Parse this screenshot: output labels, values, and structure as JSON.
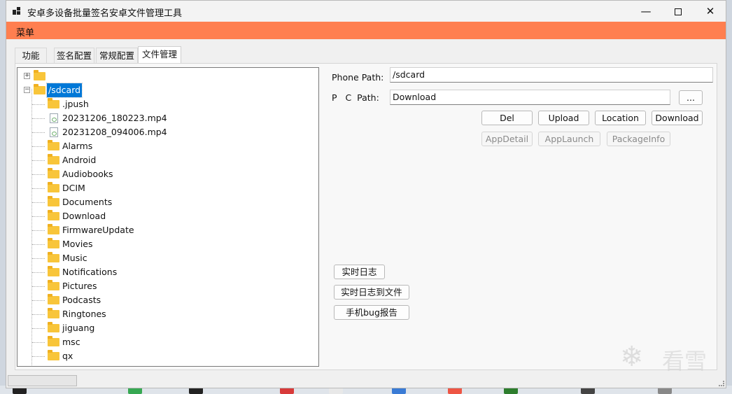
{
  "window": {
    "title": "安卓多设备批量签名安卓文件管理工具",
    "minimize_glyph": "—",
    "close_glyph": "✕"
  },
  "menu": {
    "items": [
      {
        "label": "菜单"
      }
    ]
  },
  "tabs": [
    {
      "label": "功能",
      "active": false
    },
    {
      "label": "签名配置",
      "active": false
    },
    {
      "label": "常规配置",
      "active": false
    },
    {
      "label": "文件管理",
      "active": true
    }
  ],
  "tree": {
    "root_collapsed": {
      "label": "",
      "expander": "+"
    },
    "root_expanded": {
      "label": "/sdcard",
      "expander": "−",
      "selected": true
    },
    "children": [
      {
        "label": ".jpush",
        "type": "folder"
      },
      {
        "label": "20231206_180223.mp4",
        "type": "file"
      },
      {
        "label": "20231208_094006.mp4",
        "type": "file"
      },
      {
        "label": "Alarms",
        "type": "folder"
      },
      {
        "label": "Android",
        "type": "folder"
      },
      {
        "label": "Audiobooks",
        "type": "folder"
      },
      {
        "label": "DCIM",
        "type": "folder"
      },
      {
        "label": "Documents",
        "type": "folder"
      },
      {
        "label": "Download",
        "type": "folder"
      },
      {
        "label": "FirmwareUpdate",
        "type": "folder"
      },
      {
        "label": "Movies",
        "type": "folder"
      },
      {
        "label": "Music",
        "type": "folder"
      },
      {
        "label": "Notifications",
        "type": "folder"
      },
      {
        "label": "Pictures",
        "type": "folder"
      },
      {
        "label": "Podcasts",
        "type": "folder"
      },
      {
        "label": "Ringtones",
        "type": "folder"
      },
      {
        "label": "jiguang",
        "type": "folder"
      },
      {
        "label": "msc",
        "type": "folder"
      },
      {
        "label": "qx",
        "type": "folder"
      }
    ]
  },
  "paths": {
    "phone_label": "Phone Path:",
    "phone_value": "/sdcard",
    "pc_label": "P   C  Path:",
    "pc_value": "Download",
    "browse_label": "..."
  },
  "actions": {
    "del": "Del",
    "upload": "Upload",
    "location": "Location",
    "download": "Download",
    "app_detail": "AppDetail",
    "app_launch": "AppLaunch",
    "package_info": "PackageInfo"
  },
  "log_buttons": {
    "realtime_log": "实时日志",
    "realtime_log_to_file": "实时日志到文件",
    "bug_report": "手机bug报告"
  },
  "watermark": {
    "text": "看雪",
    "icon": "snowflake-logo"
  },
  "colors": {
    "menubar": "#ff7f50",
    "selection": "#0078d7",
    "folder": "#f8c53a"
  }
}
